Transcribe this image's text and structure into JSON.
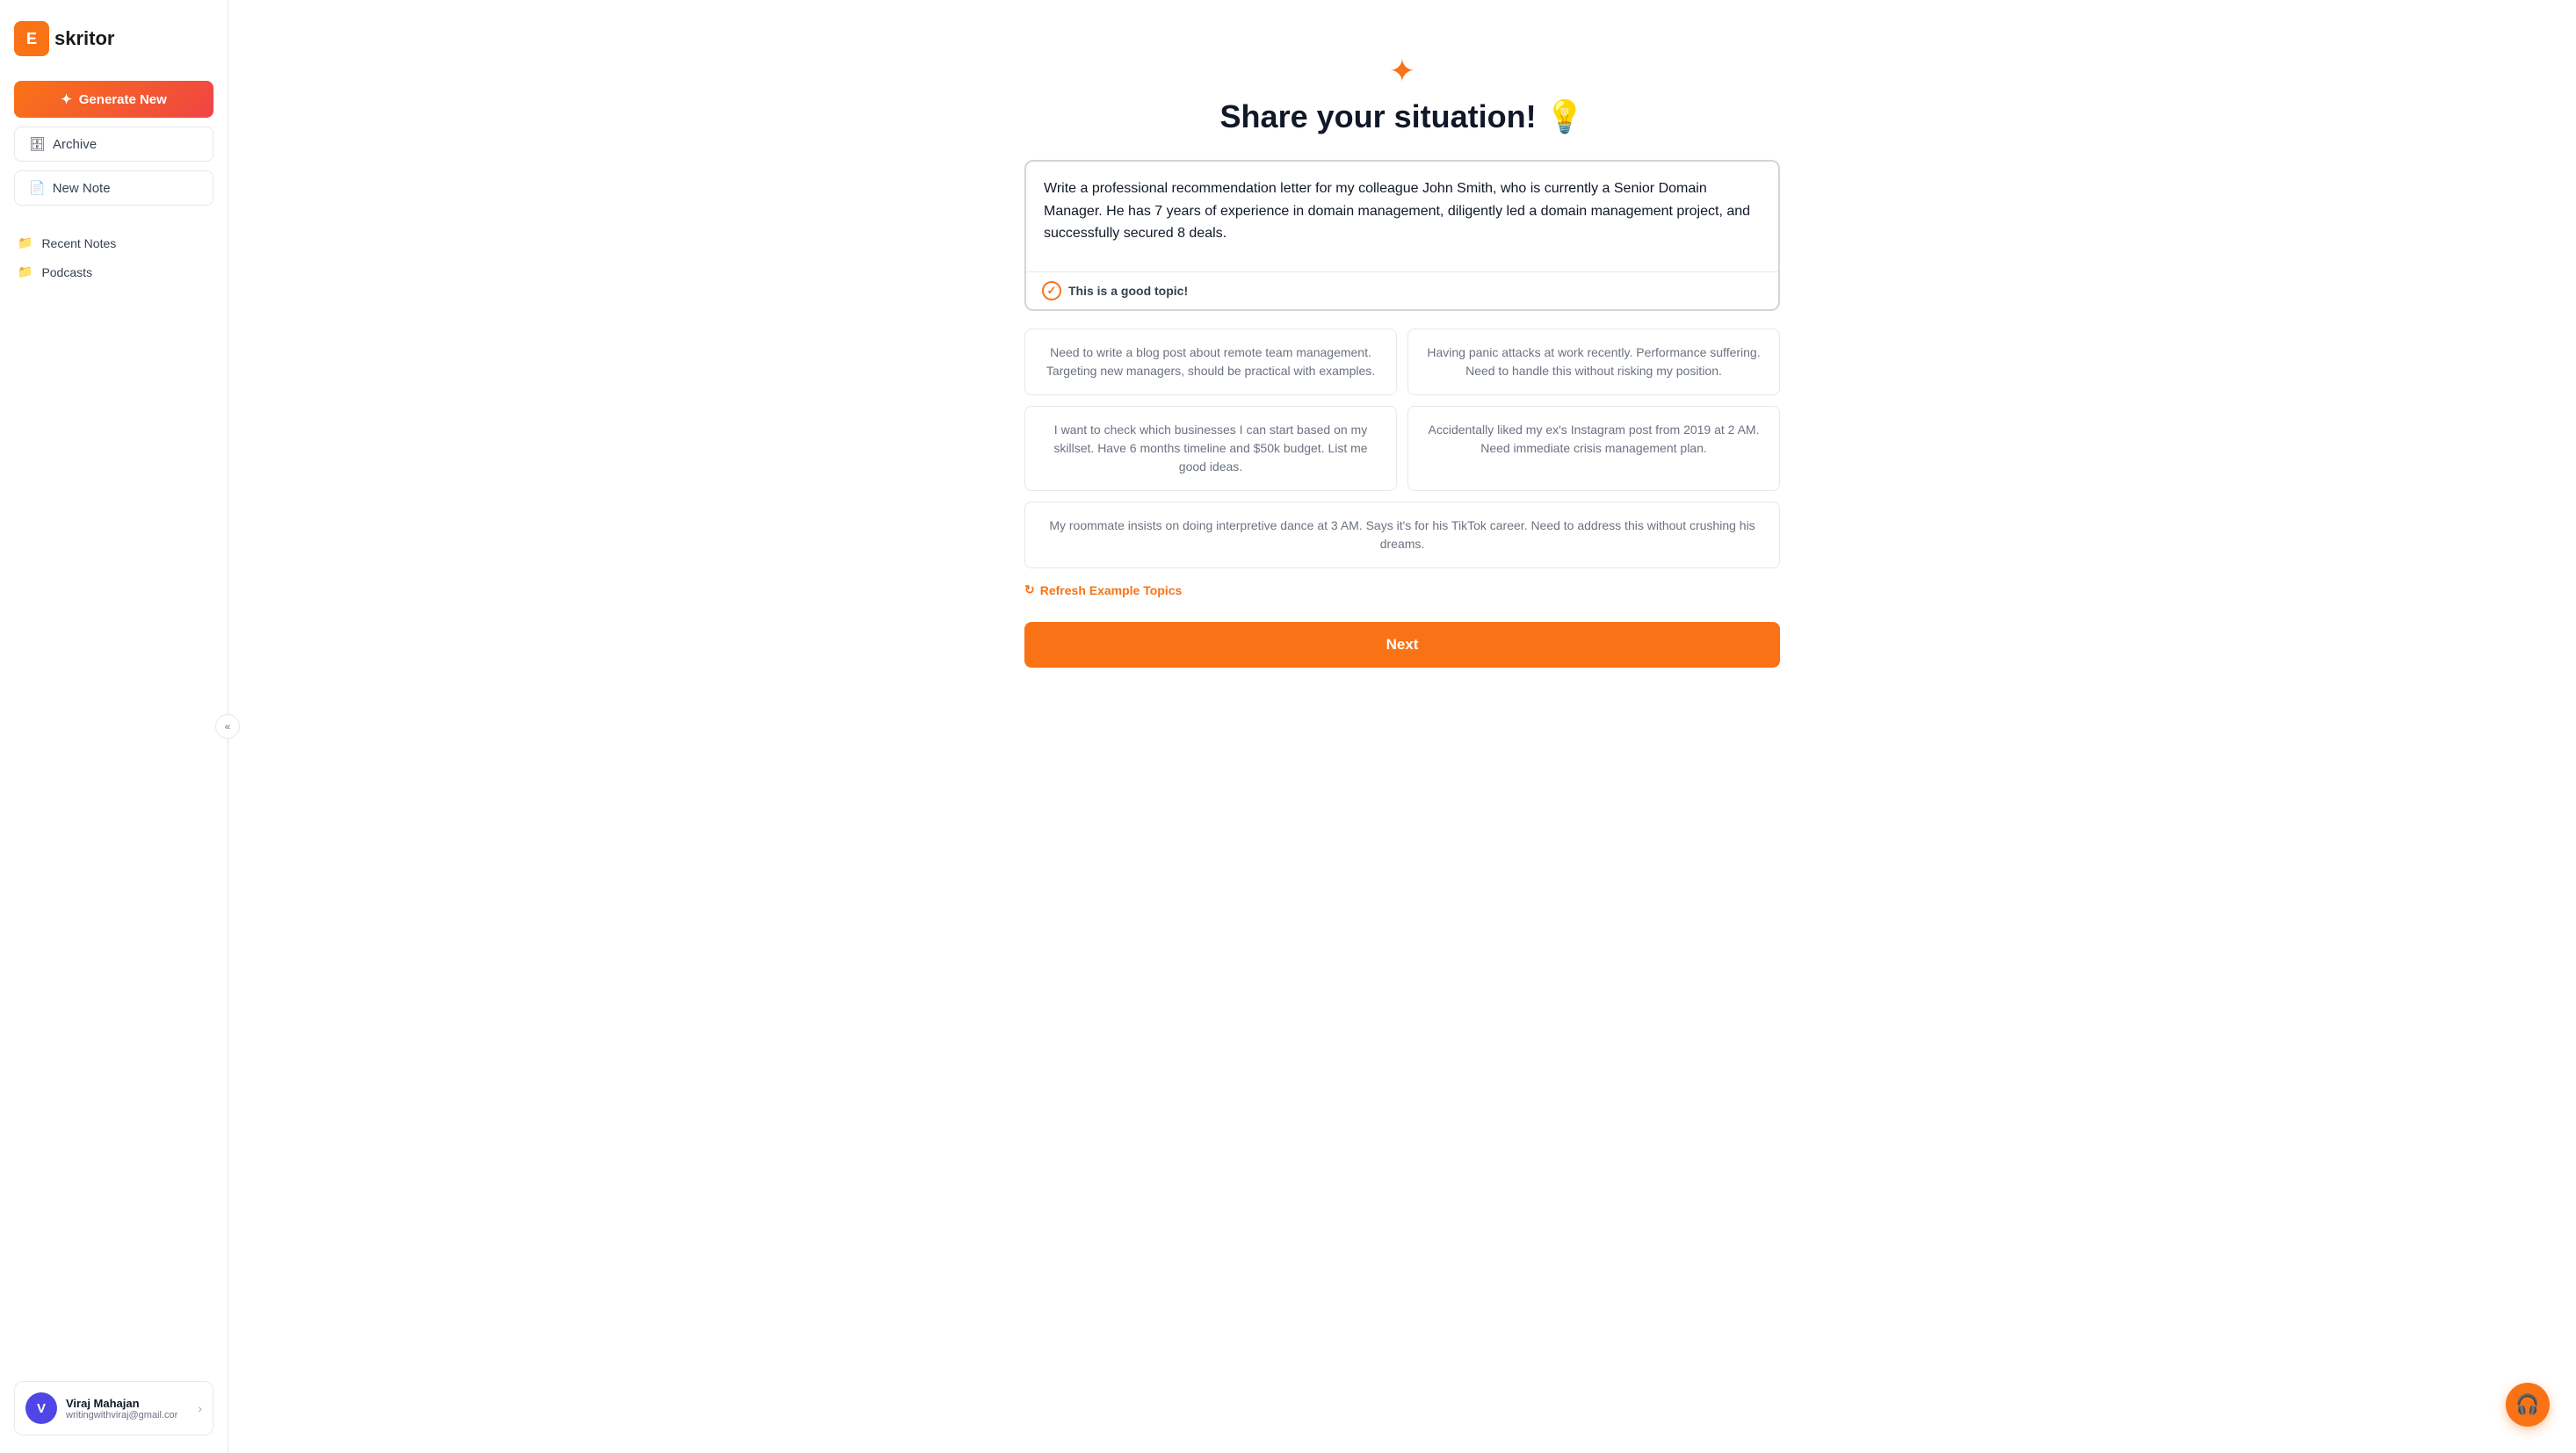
{
  "logo": {
    "icon_letter": "E",
    "text": "skritor"
  },
  "sidebar": {
    "generate_btn": "Generate New",
    "archive_btn": "Archive",
    "new_note_btn": "New Note",
    "nav_items": [
      {
        "label": "Recent Notes",
        "icon": "folder"
      },
      {
        "label": "Podcasts",
        "icon": "folder"
      }
    ],
    "collapse_icon": "«"
  },
  "user": {
    "initial": "V",
    "name": "Viraj Mahajan",
    "email": "writingwithviraj@gmail.cor"
  },
  "main": {
    "sparkle": "✦",
    "title": "Share your situation!",
    "title_emoji": "💡",
    "textarea_value": "Write a professional recommendation letter for my colleague John Smith, who is currently a Senior Domain Manager. He has 7 years of experience in domain management, diligently led a domain management project, and successfully secured 8 deals.",
    "good_topic_label": "This is a good topic!",
    "examples": [
      {
        "text": "Need to write a blog post about remote team management. Targeting new managers, should be practical with examples.",
        "full_width": false
      },
      {
        "text": "Having panic attacks at work recently. Performance suffering. Need to handle this without risking my position.",
        "full_width": false
      },
      {
        "text": "I want to check which businesses I can start based on my skillset. Have 6 months timeline and $50k budget. List me good ideas.",
        "full_width": false
      },
      {
        "text": "Accidentally liked my ex's Instagram post from 2019 at 2 AM. Need immediate crisis management plan.",
        "full_width": false
      },
      {
        "text": "My roommate insists on doing interpretive dance at 3 AM. Says it's for his TikTok career. Need to address this without crushing his dreams.",
        "full_width": true
      }
    ],
    "refresh_label": "Refresh Example Topics",
    "next_btn": "Next"
  }
}
